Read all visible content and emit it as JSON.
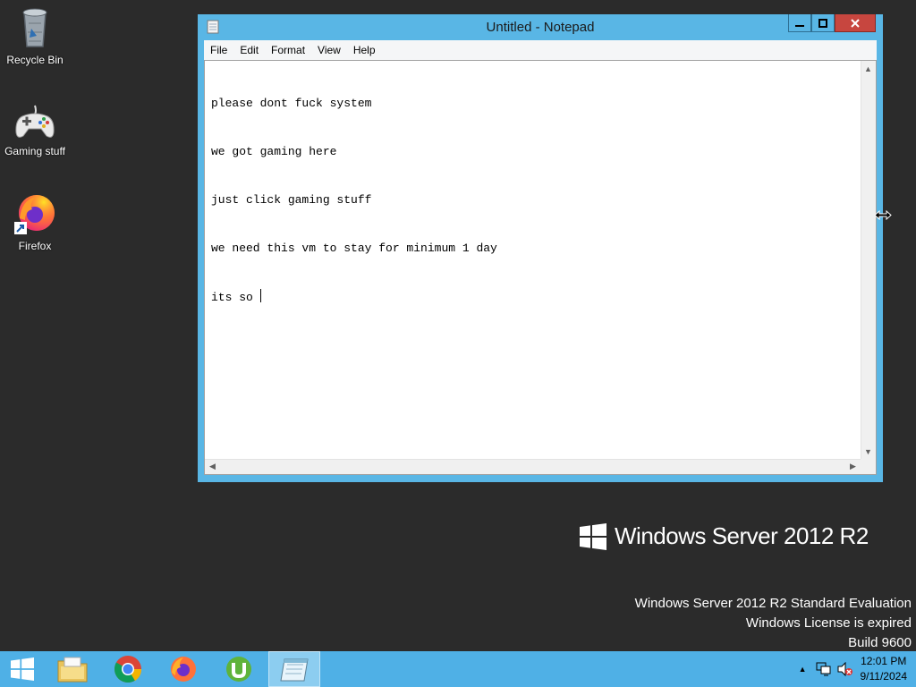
{
  "desktop": {
    "icons": [
      {
        "label": "Recycle Bin"
      },
      {
        "label": "Gaming stuff"
      },
      {
        "label": "Firefox"
      }
    ]
  },
  "notepad": {
    "title": "Untitled - Notepad",
    "menu": [
      "File",
      "Edit",
      "Format",
      "View",
      "Help"
    ],
    "lines": [
      "please dont fuck system",
      "we got gaming here",
      "just click gaming stuff",
      "we need this vm to stay for minimum 1 day",
      "its so "
    ]
  },
  "branding": {
    "logo_text": "Windows Server 2012 R2",
    "watermark": [
      "Windows Server 2012 R2 Standard Evaluation",
      "Windows License is expired",
      "Build 9600"
    ]
  },
  "taskbar": {
    "clock_time": "12:01 PM",
    "clock_date": "9/11/2024",
    "tray_arrow": "▲"
  },
  "colors": {
    "desktop": "#2b2b2b",
    "window_frame": "#59b6e5",
    "close_button": "#c7463f",
    "taskbar": "#4fb0e6"
  }
}
